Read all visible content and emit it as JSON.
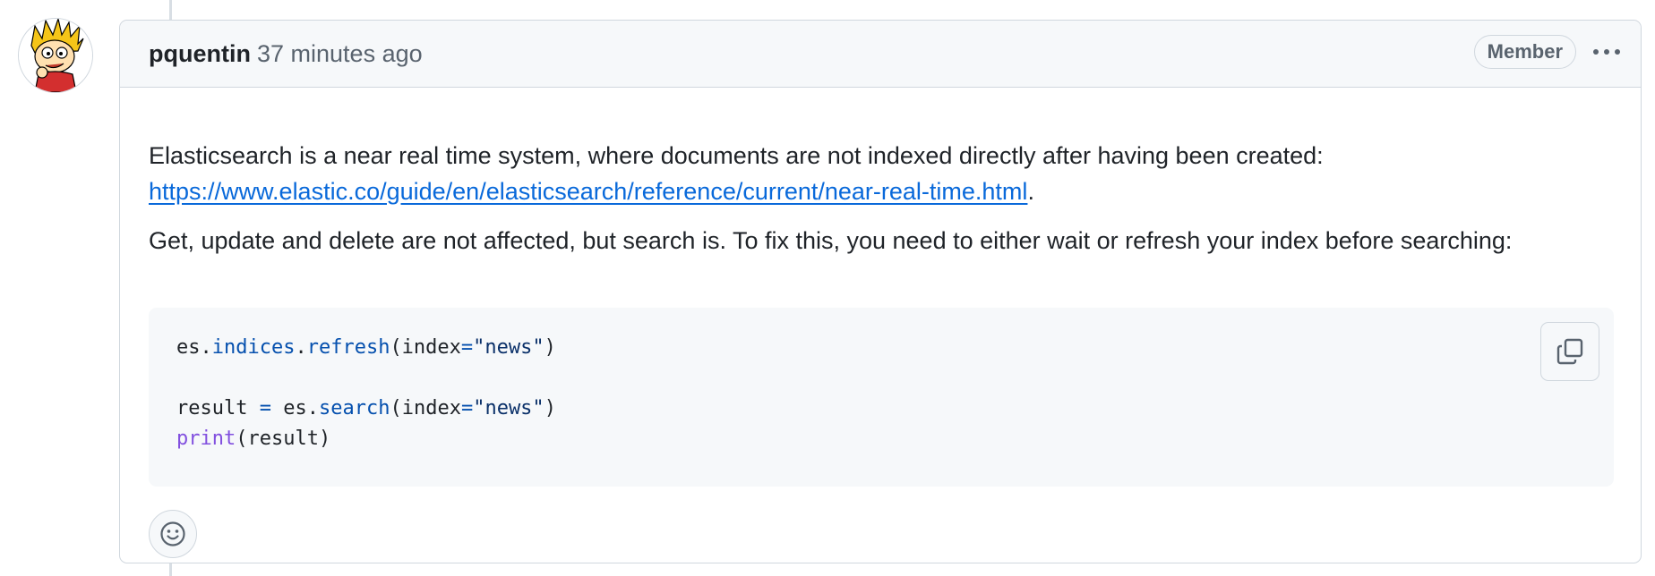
{
  "comment": {
    "author": "pquentin",
    "timestamp": "37 minutes ago",
    "badge": "Member",
    "avatar_icon": "calvin-avatar",
    "menu_icon": "kebab-horizontal-icon"
  },
  "body": {
    "para1_text": "Elasticsearch is a near real time system, where documents are not indexed directly after having been created:",
    "para1_link": "https://www.elastic.co/guide/en/elasticsearch/reference/current/near-real-time.html",
    "para1_suffix": ".",
    "para2_text": "Get, update and delete are not affected, but search is. To fix this, you need to either wait or refresh your index before searching:"
  },
  "code": {
    "line1": {
      "obj": "es",
      "dot1": ".",
      "attr1": "indices",
      "dot2": ".",
      "attr2": "refresh",
      "open": "(index",
      "eq": "=",
      "str": "\"news\"",
      "close": ")"
    },
    "line3": {
      "var": "result",
      "assign": " = ",
      "obj": "es",
      "dot": ".",
      "attr": "search",
      "open": "(index",
      "eq": "=",
      "str": "\"news\"",
      "close": ")"
    },
    "line4": {
      "builtin": "print",
      "args": "(result)"
    },
    "copy_icon": "copy-icon"
  },
  "reactions": {
    "icon": "smiley-icon"
  },
  "colors": {
    "link": "#0969da",
    "text": "#1f2328",
    "muted": "#59636e",
    "border": "#d0d7de",
    "header_bg": "#f6f8fa"
  }
}
